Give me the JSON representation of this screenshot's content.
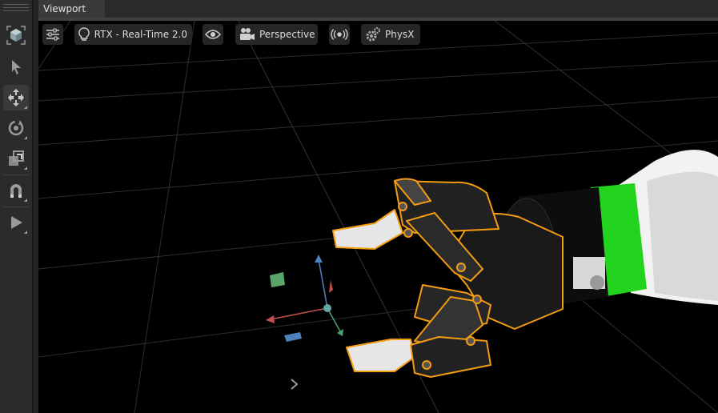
{
  "tabs": [
    {
      "label": "Viewport"
    }
  ],
  "toolbar": {
    "tools": [
      {
        "name": "select-mode-icon"
      },
      {
        "name": "select-pointer-icon"
      },
      {
        "name": "move-icon"
      },
      {
        "name": "rotate-icon"
      },
      {
        "name": "scale-icon"
      },
      {
        "name": "snap-magnet-icon"
      },
      {
        "name": "play-icon"
      }
    ]
  },
  "viewport_menu": {
    "settings_icon": "sliders-icon",
    "renderer": {
      "icon": "lightbulb-icon",
      "label": "RTX - Real-Time 2.0"
    },
    "visibility_icon": "eye-icon",
    "camera": {
      "icon": "camera-icon",
      "label": "Perspective"
    },
    "audio_icon": "audio-broadcast-icon",
    "physics": {
      "icon": "gear-icon",
      "label": "PhysX"
    }
  },
  "colors": {
    "selection_outline": "#f39c12",
    "robot_accent": "#22d41e",
    "axis_x": "#c0504d",
    "axis_y": "#4f81bd",
    "axis_z": "#4fa36f"
  }
}
